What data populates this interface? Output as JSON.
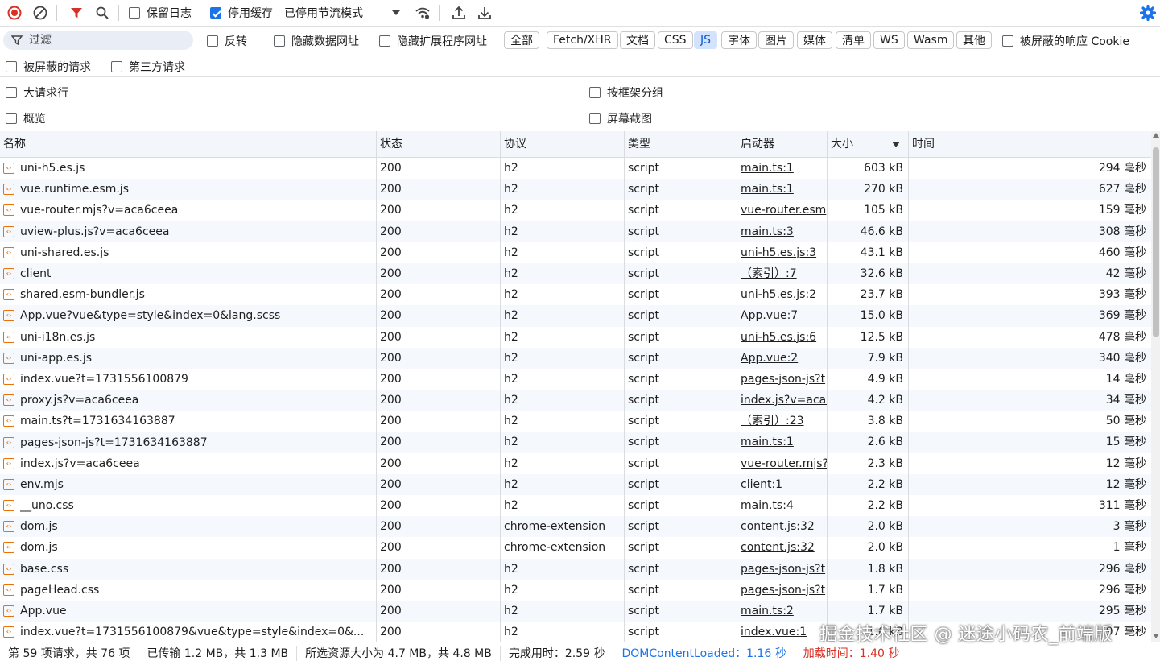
{
  "toolbar": {
    "preserve_log": "保留日志",
    "disable_cache": "停用缓存",
    "throttle": "已停用节流模式"
  },
  "filter": {
    "placeholder": "过滤",
    "invert": "反转",
    "hide_data_urls": "隐藏数据网址",
    "hide_ext_urls": "隐藏扩展程序网址",
    "types": [
      "全部",
      "Fetch/XHR",
      "文档",
      "CSS",
      "JS",
      "字体",
      "图片",
      "媒体",
      "清单",
      "WS",
      "Wasm",
      "其他"
    ],
    "active_type": "JS",
    "blocked_cookies": "被屏蔽的响应 Cookie",
    "blocked_requests": "被屏蔽的请求",
    "third_party": "第三方请求"
  },
  "options": {
    "big_rows": "大请求行",
    "group_by_frame": "按框架分组",
    "overview": "概览",
    "screenshots": "屏幕截图"
  },
  "table": {
    "headers": [
      "名称",
      "状态",
      "协议",
      "类型",
      "启动器",
      "大小",
      "时间"
    ],
    "rows": [
      [
        "uni-h5.es.js",
        "200",
        "h2",
        "script",
        "main.ts:1",
        "603 kB",
        "294 毫秒"
      ],
      [
        "vue.runtime.esm.js",
        "200",
        "h2",
        "script",
        "main.ts:1",
        "270 kB",
        "627 毫秒"
      ],
      [
        "vue-router.mjs?v=aca6ceea",
        "200",
        "h2",
        "script",
        "vue-router.esm",
        "105 kB",
        "159 毫秒"
      ],
      [
        "uview-plus.js?v=aca6ceea",
        "200",
        "h2",
        "script",
        "main.ts:3",
        "46.6 kB",
        "308 毫秒"
      ],
      [
        "uni-shared.es.js",
        "200",
        "h2",
        "script",
        "uni-h5.es.js:3",
        "43.1 kB",
        "460 毫秒"
      ],
      [
        "client",
        "200",
        "h2",
        "script",
        "（索引）:7",
        "32.6 kB",
        "42 毫秒"
      ],
      [
        "shared.esm-bundler.js",
        "200",
        "h2",
        "script",
        "uni-h5.es.js:2",
        "23.7 kB",
        "393 毫秒"
      ],
      [
        "App.vue?vue&type=style&index=0&lang.scss",
        "200",
        "h2",
        "script",
        "App.vue:7",
        "15.0 kB",
        "369 毫秒"
      ],
      [
        "uni-i18n.es.js",
        "200",
        "h2",
        "script",
        "uni-h5.es.js:6",
        "12.5 kB",
        "478 毫秒"
      ],
      [
        "uni-app.es.js",
        "200",
        "h2",
        "script",
        "App.vue:2",
        "7.9 kB",
        "340 毫秒"
      ],
      [
        "index.vue?t=1731556100879",
        "200",
        "h2",
        "script",
        "pages-json-js?t",
        "4.9 kB",
        "14 毫秒"
      ],
      [
        "proxy.js?v=aca6ceea",
        "200",
        "h2",
        "script",
        "index.js?v=aca6",
        "4.2 kB",
        "34 毫秒"
      ],
      [
        "main.ts?t=1731634163887",
        "200",
        "h2",
        "script",
        "（索引）:23",
        "3.8 kB",
        "50 毫秒"
      ],
      [
        "pages-json-js?t=1731634163887",
        "200",
        "h2",
        "script",
        "main.ts:1",
        "2.6 kB",
        "15 毫秒"
      ],
      [
        "index.js?v=aca6ceea",
        "200",
        "h2",
        "script",
        "vue-router.mjs?",
        "2.3 kB",
        "12 毫秒"
      ],
      [
        "env.mjs",
        "200",
        "h2",
        "script",
        "client:1",
        "2.2 kB",
        "12 毫秒"
      ],
      [
        "__uno.css",
        "200",
        "h2",
        "script",
        "main.ts:4",
        "2.2 kB",
        "311 毫秒"
      ],
      [
        "dom.js",
        "200",
        "chrome-extension",
        "script",
        "content.js:32",
        "2.0 kB",
        "3 毫秒"
      ],
      [
        "dom.js",
        "200",
        "chrome-extension",
        "script",
        "content.js:32",
        "2.0 kB",
        "1 毫秒"
      ],
      [
        "base.css",
        "200",
        "h2",
        "script",
        "pages-json-js?t",
        "1.8 kB",
        "296 毫秒"
      ],
      [
        "pageHead.css",
        "200",
        "h2",
        "script",
        "pages-json-js?t",
        "1.7 kB",
        "296 毫秒"
      ],
      [
        "App.vue",
        "200",
        "h2",
        "script",
        "main.ts:2",
        "1.7 kB",
        "295 毫秒"
      ],
      [
        "index.vue?t=1731556100879&vue&type=style&index=0&...",
        "200",
        "h2",
        "script",
        "index.vue:1",
        "1.6 kB",
        "97 毫秒"
      ]
    ]
  },
  "status": {
    "requests": "第 59 项请求，共 76 项",
    "transferred": "已传输 1.2 MB，共 1.3 MB",
    "resources": "所选资源大小为 4.7 MB，共 4.8 MB",
    "finish": "完成用时：2.59 秒",
    "dcl": "DOMContentLoaded：1.16 秒",
    "load": "加载时间：1.40 秒"
  },
  "watermark": "掘金技术社区 @ 迷途小码农_前端版",
  "colors": {
    "accent": "#1a73e8",
    "record": "#d93025",
    "filter_active": "#d3e3fd"
  }
}
